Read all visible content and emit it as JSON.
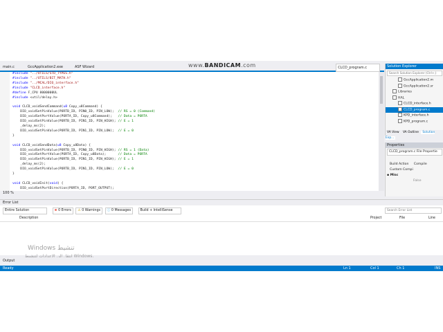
{
  "watermark": {
    "prefix": "www.",
    "brand": "BANDICAM",
    "suffix": ".com"
  },
  "tabs": [
    {
      "label": "main.c"
    },
    {
      "label": "GccApplication2.exe"
    },
    {
      "label": "ASF Wizard"
    }
  ],
  "editor_tab_right": {
    "label": "CLCD_program.c"
  },
  "code_lines": [
    "#include \"../UTILS/STD_TYPES.h\"",
    "#include \"../UTILS/BIT_MATH.h\"",
    "#include \"../MCAL/DIO_interface.h\"",
    "#include \"CLCD_interface.h\"",
    "#define F_CPU 8000000UL",
    "#include <util/delay.h>",
    "",
    "void CLCD_voidSendCommand(u8 Copy_u8Command) {",
    "    DIO_voidSetPinValue(PORTB_ID, PIN0_ID, PIN_LOW);  // RS = 0 (Command)",
    "    DIO_voidSetPortValue(PORTA_ID, Copy_u8Command);   // Data = PORTA",
    "    DIO_voidSetPinValue(PORTB_ID, PIN1_ID, PIN_HIGH); // E = 1",
    "    _delay_ms(2);",
    "    DIO_voidSetPinValue(PORTB_ID, PIN1_ID, PIN_LOW);  // E = 0",
    "}",
    "",
    "void CLCD_voidSendData(u8 Copy_u8Data) {",
    "    DIO_voidSetPinValue(PORTB_ID, PIN0_ID, PIN_HIGH); // RS = 1 (Data)",
    "    DIO_voidSetPortValue(PORTA_ID, Copy_u8Data);      // Data = PORTA",
    "    DIO_voidSetPinValue(PORTB_ID, PIN1_ID, PIN_HIGH); // E = 1",
    "    _delay_ms(2);",
    "    DIO_voidSetPinValue(PORTB_ID, PIN1_ID, PIN_LOW);  // E = 0",
    "}",
    "",
    "void CLCD_voidInit(void) {",
    "    DIO_voidSetPortDirection(PORTA_ID, PORT_OUTPUT);"
  ],
  "editor_zoom": "100 %",
  "solution_explorer": {
    "title": "Solution Explorer",
    "search_placeholder": "Search Solution Explorer (Ctrl+;)",
    "items": [
      {
        "label": "GccApplication2.m",
        "indent": 1,
        "selected": false
      },
      {
        "label": "GccApplication2.sr",
        "indent": 1,
        "selected": false
      },
      {
        "label": "Libraries",
        "indent": 0,
        "selected": false
      },
      {
        "label": "HAL",
        "indent": 0,
        "selected": false
      },
      {
        "label": "CLCD_interface.h",
        "indent": 1,
        "selected": false
      },
      {
        "label": "CLCD_program.c",
        "indent": 1,
        "selected": true
      },
      {
        "label": "KPD_interface.h",
        "indent": 1,
        "selected": false
      },
      {
        "label": "KPD_program.c",
        "indent": 1,
        "selected": false
      }
    ],
    "bottom_tabs": [
      "VA View",
      "VA Outline",
      "Solution Exp..."
    ]
  },
  "properties": {
    "title": "Properties",
    "object": "CLCD_program.c File Propertie",
    "rows": [
      {
        "name": "Build Action",
        "value": "Compile"
      },
      {
        "name": "Custom Compi",
        "value": ""
      }
    ],
    "section": "Misc",
    "misc_value": "False"
  },
  "error_list": {
    "title": "Error List",
    "scope": "Entire Solution",
    "errors": "0 Errors",
    "warnings": "0 Warnings",
    "messages": "0 Messages",
    "build_filter": "Build + IntelliSense",
    "search_placeholder": "Search Error List",
    "columns": [
      "Description",
      "Project",
      "File",
      "Line"
    ]
  },
  "windows_watermark": {
    "line1": "Windows تنشيط",
    "line2": "انتقل إلى الإعدادات لتنشيط Windows."
  },
  "output_tab": "Output",
  "statusbar": {
    "left": "Ready",
    "ln": "Ln 1",
    "col": "Col 1",
    "ch": "Ch 1",
    "mode": "INS"
  }
}
